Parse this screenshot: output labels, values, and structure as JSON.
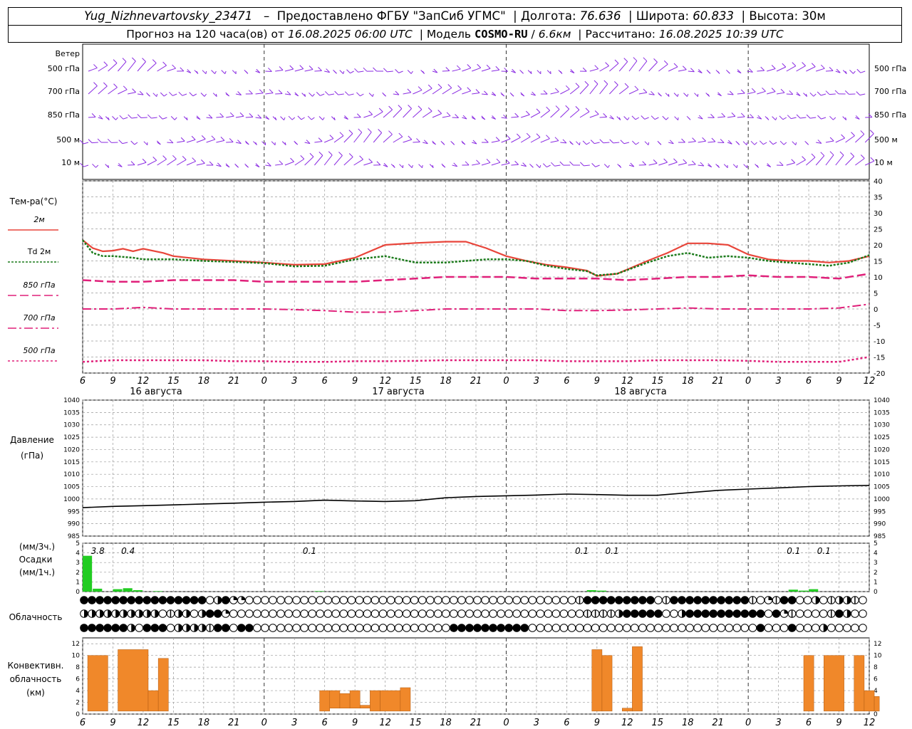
{
  "header": {
    "station": "Yug_Nizhnevartovsky_23471",
    "provider": "Предоставлено ФГБУ \"ЗапСиб УГМС\"",
    "lon_label": "Долгота:",
    "lon": "76.636",
    "lat_label": "Широта:",
    "lat": "60.833",
    "alt_label": "Высота:",
    "alt": "30м",
    "forecast_prefix": "Прогноз на 120 часа(ов) от",
    "forecast_from": "16.08.2025 06:00 UTC",
    "model_label": "Модель",
    "model": "COSMO-RU",
    "resolution": "6.6км",
    "calc_label": "Рассчитано:",
    "calc_time": "16.08.2025 10:39 UTC"
  },
  "labels": {
    "wind": "Ветер",
    "wind_levels": [
      "500 гПа",
      "700 гПа",
      "850 гПа",
      "500 м",
      "10 м"
    ],
    "temp_title": "Тем-ра(°C)",
    "legend": [
      "2м",
      "Td 2м",
      "850 гПа",
      "700 гПа",
      "500 гПа"
    ],
    "pressure_title": "Давление",
    "pressure_unit": "(гПа)",
    "precip_unit_3h": "(мм/3ч.)",
    "precip_title": "Осадки",
    "precip_unit_1h": "(мм/1ч.)",
    "cloud_title": "Облачность",
    "conv_title_1": "Конвективн.",
    "conv_title_2": "облачность",
    "conv_unit": "(км)",
    "days": [
      "16 августа",
      "17 августа",
      "18 августа"
    ]
  },
  "colors": {
    "wind": "#8a2be2",
    "t2m": "#e8453a",
    "td2m": "#1a7a1a",
    "t850": "#e0207a",
    "t700": "#e0207a",
    "t500": "#e0207a",
    "pressure": "#000000",
    "precip": "#22cc22",
    "convective": "#f0882a",
    "grid": "#9a9a9a"
  },
  "chart_data": [
    {
      "type": "line",
      "title": "Тем-ра(°C)",
      "x_hours": [
        0,
        3,
        6,
        9,
        12,
        15,
        18,
        21,
        24,
        27,
        30,
        33,
        36,
        39,
        42,
        45,
        48,
        51,
        54,
        57,
        60,
        63,
        66,
        69,
        72,
        75,
        78
      ],
      "x_tick_labels": [
        "6",
        "9",
        "12",
        "15",
        "18",
        "21",
        "0",
        "3",
        "6",
        "9",
        "12",
        "15",
        "18",
        "21",
        "0",
        "3",
        "6",
        "9",
        "12",
        "15",
        "18",
        "21",
        "0",
        "3",
        "6",
        "9",
        "12"
      ],
      "ylim": [
        -20,
        40
      ],
      "y_ticks": [
        -20,
        -15,
        -10,
        -5,
        0,
        5,
        10,
        15,
        20,
        25,
        30,
        35,
        40
      ],
      "series": [
        {
          "name": "2м",
          "key": "t2m",
          "style": "solid",
          "x": [
            0,
            1,
            2,
            3,
            4,
            5,
            6,
            8,
            9,
            12,
            15,
            18,
            21,
            24,
            27,
            30,
            33,
            36,
            38,
            40,
            42,
            44,
            46,
            48,
            50,
            51,
            53,
            56,
            58,
            60,
            62,
            64,
            66,
            68,
            70,
            72,
            74,
            76,
            78
          ],
          "values": [
            21.5,
            19,
            18,
            18.2,
            18.8,
            18,
            18.8,
            17.5,
            16.5,
            15.5,
            15,
            14.5,
            13.8,
            14,
            16,
            20,
            20.6,
            21,
            21,
            19,
            16.5,
            15,
            13.8,
            13,
            12,
            10.3,
            11,
            15,
            17.5,
            20.5,
            20.5,
            20,
            17,
            15.5,
            15,
            15,
            14.5,
            15,
            16.5
          ]
        },
        {
          "name": "Td 2м",
          "key": "td2m",
          "style": "dot",
          "x": [
            0,
            1,
            2,
            3,
            5,
            6,
            9,
            12,
            15,
            18,
            21,
            24,
            27,
            30,
            33,
            36,
            38,
            40,
            42,
            44,
            46,
            48,
            50,
            51,
            53,
            56,
            58,
            60,
            62,
            64,
            66,
            68,
            70,
            72,
            74,
            76,
            78
          ],
          "values": [
            21.5,
            17.5,
            16.5,
            16.5,
            16,
            15.5,
            15.5,
            15,
            14.7,
            14.3,
            13.3,
            13.5,
            15.5,
            16.5,
            14.5,
            14.5,
            15,
            15.5,
            15.5,
            15,
            13.5,
            12.5,
            11.8,
            10.5,
            11,
            14.5,
            16.5,
            17.5,
            16,
            16.5,
            16,
            15,
            14.5,
            14,
            13.5,
            14.5,
            16.8
          ]
        },
        {
          "name": "850 гПа",
          "key": "t850",
          "style": "dash",
          "x": [
            0,
            3,
            6,
            9,
            12,
            15,
            18,
            21,
            24,
            27,
            30,
            33,
            36,
            39,
            42,
            45,
            48,
            51,
            54,
            57,
            60,
            63,
            66,
            69,
            72,
            75,
            78
          ],
          "values": [
            9,
            8.5,
            8.5,
            9,
            9,
            9,
            8.5,
            8.5,
            8.5,
            8.5,
            9,
            9.5,
            10,
            10,
            10,
            9.5,
            9.5,
            9.5,
            9,
            9.5,
            10,
            10,
            10.5,
            10,
            10,
            9.5,
            11
          ]
        },
        {
          "name": "700 гПа",
          "key": "t700",
          "style": "dashdot",
          "x": [
            0,
            3,
            6,
            9,
            12,
            15,
            18,
            21,
            24,
            27,
            30,
            33,
            36,
            39,
            42,
            45,
            48,
            51,
            54,
            57,
            60,
            63,
            66,
            69,
            72,
            75,
            78
          ],
          "values": [
            0,
            0,
            0.5,
            0,
            0,
            0,
            0,
            -0.2,
            -0.5,
            -1,
            -1,
            -0.5,
            0,
            0,
            0,
            0,
            -0.5,
            -0.5,
            -0.3,
            0,
            0.3,
            0,
            0,
            0,
            0,
            0.3,
            1.5
          ]
        },
        {
          "name": "500 гПа",
          "key": "t500",
          "style": "dotdash",
          "x": [
            0,
            3,
            6,
            9,
            12,
            15,
            18,
            21,
            24,
            27,
            30,
            33,
            36,
            39,
            42,
            45,
            48,
            51,
            54,
            57,
            60,
            63,
            66,
            69,
            72,
            75,
            78
          ],
          "values": [
            -16.5,
            -16,
            -16,
            -16,
            -16,
            -16.3,
            -16.3,
            -16.5,
            -16.5,
            -16.3,
            -16.3,
            -16.2,
            -16,
            -16,
            -16,
            -16,
            -16.3,
            -16.3,
            -16.3,
            -16,
            -16,
            -16,
            -16.2,
            -16.5,
            -16.5,
            -16.5,
            -15
          ]
        }
      ]
    },
    {
      "type": "line",
      "title": "Давление",
      "ylabel": "(гПа)",
      "ylim": [
        985,
        1040
      ],
      "y_ticks": [
        985,
        990,
        995,
        1000,
        1005,
        1010,
        1015,
        1020,
        1025,
        1030,
        1035,
        1040
      ],
      "series": [
        {
          "name": "",
          "key": "pressure",
          "x": [
            0,
            3,
            6,
            9,
            12,
            15,
            18,
            21,
            24,
            27,
            30,
            33,
            36,
            39,
            42,
            45,
            48,
            51,
            54,
            57,
            60,
            63,
            66,
            69,
            72,
            75,
            78
          ],
          "values": [
            996.5,
            997,
            997.3,
            997.6,
            998,
            998.3,
            998.7,
            999,
            999.5,
            999.2,
            999,
            999.3,
            1000.5,
            1001,
            1001.3,
            1001.6,
            1002,
            1001.8,
            1001.5,
            1001.5,
            1002.5,
            1003.5,
            1004,
            1004.5,
            1005,
            1005.3,
            1005.5
          ]
        }
      ]
    },
    {
      "type": "bar",
      "title": "Осадки",
      "ylim": [
        0,
        5
      ],
      "y_ticks": [
        0,
        1,
        2,
        3,
        4,
        5
      ],
      "bars_hour": [
        0,
        1,
        3,
        4,
        5,
        7,
        23,
        50,
        51,
        70,
        71,
        72
      ],
      "bars_mm": [
        3.7,
        0.3,
        0.25,
        0.35,
        0.15,
        0.05,
        0.05,
        0.15,
        0.1,
        0.2,
        0.1,
        0.25
      ],
      "labels_3h": [
        {
          "hour": 1.5,
          "text": "3.8"
        },
        {
          "hour": 4.5,
          "text": "0.4"
        },
        {
          "hour": 22.5,
          "text": "0.1"
        },
        {
          "hour": 49.5,
          "text": "0.1"
        },
        {
          "hour": 52.5,
          "text": "0.1"
        },
        {
          "hour": 70.5,
          "text": "0.1"
        },
        {
          "hour": 73.5,
          "text": "0.1"
        }
      ]
    },
    {
      "type": "bar",
      "title": "Конвективн. облачность",
      "ylabel": "(км)",
      "ylim": [
        0,
        12
      ],
      "y_ticks": [
        0,
        2,
        4,
        6,
        8,
        10,
        12
      ],
      "bars": [
        [
          0.5,
          2.5,
          0.5,
          10
        ],
        [
          3.5,
          6.5,
          0.5,
          11
        ],
        [
          6.5,
          7.5,
          0.5,
          4
        ],
        [
          7.5,
          8.5,
          0.5,
          9.5
        ],
        [
          23.5,
          24.5,
          0.5,
          4
        ],
        [
          24.5,
          25.5,
          1,
          4
        ],
        [
          25.5,
          26.5,
          1,
          3.5
        ],
        [
          26.5,
          27.5,
          1,
          4
        ],
        [
          27.5,
          28.5,
          1,
          1.5
        ],
        [
          28.5,
          29.5,
          0.5,
          4
        ],
        [
          29.5,
          31.5,
          0.5,
          4
        ],
        [
          31.5,
          32.5,
          0.5,
          4.5
        ],
        [
          50.5,
          51.5,
          0.5,
          11
        ],
        [
          51.5,
          52.5,
          0.5,
          10
        ],
        [
          53.5,
          54.5,
          0.5,
          1
        ],
        [
          54.5,
          55.5,
          0.5,
          11.5
        ],
        [
          71.5,
          72.5,
          0.5,
          10
        ],
        [
          72.5,
          73.5,
          0.5,
          0.5
        ],
        [
          73.5,
          75.5,
          0.5,
          10
        ],
        [
          76.5,
          77.5,
          0.5,
          10
        ],
        [
          77.5,
          78.5,
          0.5,
          4
        ],
        [
          78.5,
          79,
          0.5,
          3
        ]
      ]
    }
  ],
  "clouds": {
    "rows": [
      "3333333333333333023440000000000000000000000000000000000000000001333333333013333333333104133002012210",
      "2222222222012202334000000000000000000000000000000000000000000000111123333300233333333330341000013200",
      "3333332033302222133033000000000000000000000000033333333330000000000000000000000000000030003000200000"
    ]
  }
}
